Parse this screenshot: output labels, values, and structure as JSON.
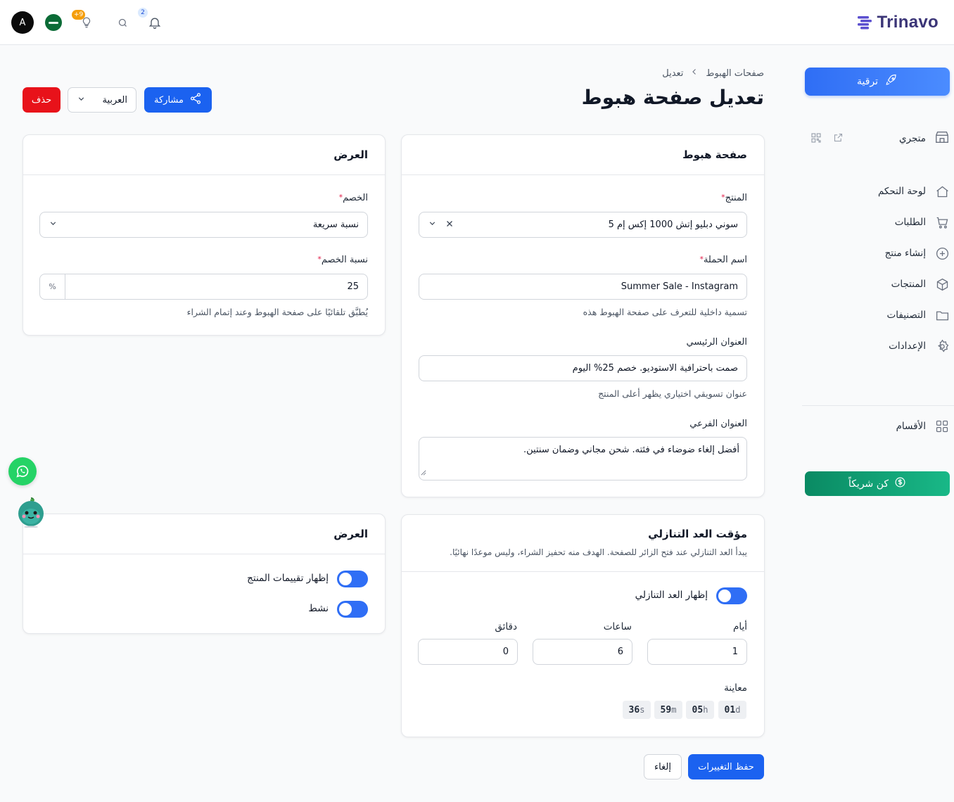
{
  "topbar": {
    "avatar_letter": "A",
    "ideas_badge": "+9",
    "notifications_badge": "2",
    "logo_text": "Trinavo"
  },
  "sidebar": {
    "upgrade_label": "ترقية",
    "store_label": "متجري",
    "items": [
      {
        "label": "لوحة التحكم",
        "icon": "home-icon"
      },
      {
        "label": "الطلبات",
        "icon": "cart-icon"
      },
      {
        "label": "إنشاء منتج",
        "icon": "plus-circle-icon"
      },
      {
        "label": "المنتجات",
        "icon": "box-icon"
      },
      {
        "label": "التصنيفات",
        "icon": "folder-icon"
      },
      {
        "label": "الإعدادات",
        "icon": "gear-icon"
      }
    ],
    "sections_label": "الأقسام",
    "partner_label": "كن شريكاً"
  },
  "header": {
    "breadcrumb_parent": "صفحات الهبوط",
    "breadcrumb_current": "تعديل",
    "title": "تعديل صفحة هبوط",
    "delete_label": "حذف",
    "language_value": "العربية",
    "share_label": "مشاركة"
  },
  "landing_card": {
    "title": "صفحة هبوط",
    "product_label": "المنتج",
    "product_value": "سوني دبليو إتش 1000 إكس إم 5",
    "campaign_label": "اسم الحملة",
    "campaign_value": "Summer Sale - Instagram",
    "campaign_hint": "تسمية داخلية للتعرف على صفحة الهبوط هذه",
    "headline_label": "العنوان الرئيسي",
    "headline_value": "صمت باحترافية الاستوديو. خصم 25% اليوم",
    "headline_hint": "عنوان تسويقي اختياري يظهر أعلى المنتج",
    "subheadline_label": "العنوان الفرعي",
    "subheadline_value": "أفضل إلغاء ضوضاء في فئته. شحن مجاني وضمان سنتين."
  },
  "offer_card": {
    "title": "العرض",
    "discount_label": "الخصم",
    "discount_value": "نسبة سريعة",
    "rate_label": "نسبة الخصم",
    "rate_value": "25",
    "rate_suffix": "%",
    "rate_hint": "يُطبَّق تلقائيًا على صفحة الهبوط وعند إتمام الشراء"
  },
  "display_card": {
    "title": "العرض",
    "show_reviews_label": "إظهار تقييمات المنتج",
    "show_reviews_on": true,
    "active_label": "نشط",
    "active_on": true
  },
  "countdown_card": {
    "title": "مؤقت العد التنازلي",
    "subtitle": "يبدأ العد التنازلي عند فتح الزائر للصفحة. الهدف منه تحفيز الشراء، وليس موعدًا نهائيًا.",
    "show_label": "إظهار العد التنازلي",
    "show_on": true,
    "days_label": "أيام",
    "days_value": "1",
    "hours_label": "ساعات",
    "hours_value": "6",
    "minutes_label": "دقائق",
    "minutes_value": "0",
    "preview_label": "معاينة",
    "preview": {
      "days_num": "01",
      "days_unit": "d",
      "hours_num": "05",
      "hours_unit": "h",
      "minutes_num": "59",
      "minutes_unit": "m",
      "seconds_num": "36",
      "seconds_unit": "s"
    }
  },
  "footer": {
    "save_label": "حفظ التغييرات",
    "cancel_label": "إلغاء"
  },
  "colors": {
    "primary": "#1b62f0",
    "danger": "#e8121a",
    "partner": "#0a8a63"
  }
}
